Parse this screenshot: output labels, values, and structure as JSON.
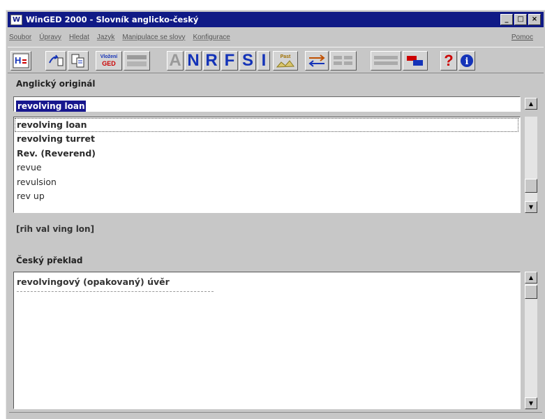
{
  "window": {
    "title": "WinGED 2000 - Slovník anglicko-český",
    "app_icon": "W",
    "controls": [
      "_",
      "□",
      "×"
    ]
  },
  "menu": {
    "items": [
      "Soubor",
      "Úpravy",
      "Hledat",
      "Jazyk",
      "Manipulace se slovy",
      "Konfigurace"
    ],
    "help": "Pomoc"
  },
  "toolbar": {
    "language_button": "H",
    "letter_buttons": [
      "A",
      "N",
      "R",
      "F",
      "S",
      "I"
    ],
    "help_button": "?",
    "info_button": "i",
    "vlozeni_label": "Vložení",
    "ged_label": "GED",
    "past_label": "Past"
  },
  "source": {
    "label": "Anglický originál",
    "entry_value": "revolving loan",
    "list": [
      "revolving loan",
      "revolving turret",
      "Rev. (Reverend)",
      "revue",
      "revulsion",
      "rev up"
    ],
    "pronunciation": "[rih val ving lon]"
  },
  "target": {
    "label": "Český překlad",
    "translation": "revolvingový (opakovaný) úvěr"
  },
  "icons": [
    "app-icon",
    "language-switch-icon",
    "open-icon",
    "copy-icon",
    "insert-ged-icon",
    "grayed-icon",
    "past-icon",
    "swap-arrows-icon",
    "settings-icon",
    "export-icon",
    "help-icon",
    "info-icon"
  ],
  "colors": {
    "titlebar": "#101a86",
    "window_bg": "#c7c7c7",
    "accent_blue": "#1433b8",
    "selection": "#17178e"
  }
}
